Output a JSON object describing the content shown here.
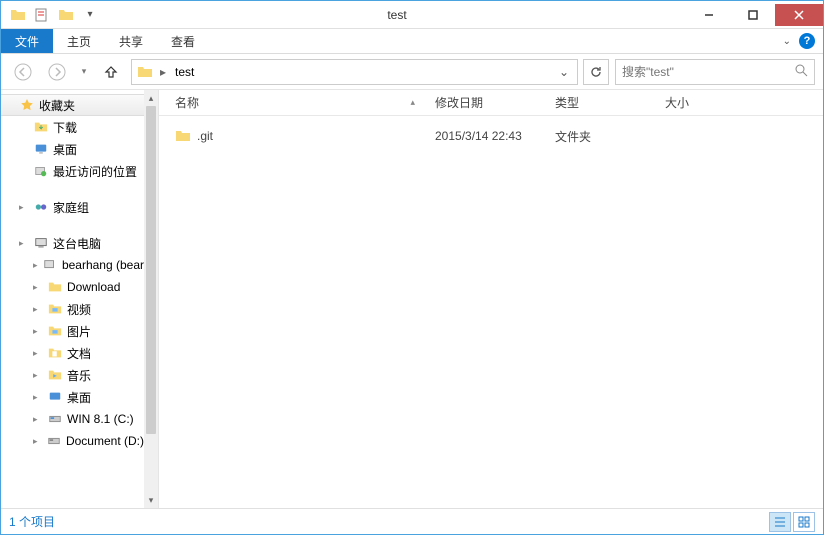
{
  "window": {
    "title": "test"
  },
  "ribbon": {
    "file": "文件",
    "home": "主页",
    "share": "共享",
    "view": "查看"
  },
  "nav": {
    "breadcrumb_root": "test",
    "search_placeholder": "搜索\"test\""
  },
  "sidebar": {
    "favorites": {
      "label": "收藏夹",
      "downloads": "下载",
      "desktop": "桌面",
      "recent": "最近访问的位置"
    },
    "homegroup": {
      "label": "家庭组"
    },
    "thispc": {
      "label": "这台电脑",
      "items": [
        "bearhang (bear",
        "Download",
        "视频",
        "图片",
        "文档",
        "音乐",
        "桌面",
        "WIN 8.1 (C:)",
        "Document (D:)"
      ]
    }
  },
  "columns": {
    "name": "名称",
    "date": "修改日期",
    "type": "类型",
    "size": "大小"
  },
  "files": [
    {
      "name": ".git",
      "date": "2015/3/14 22:43",
      "type": "文件夹",
      "size": ""
    }
  ],
  "status": {
    "count": "1 个项目"
  }
}
